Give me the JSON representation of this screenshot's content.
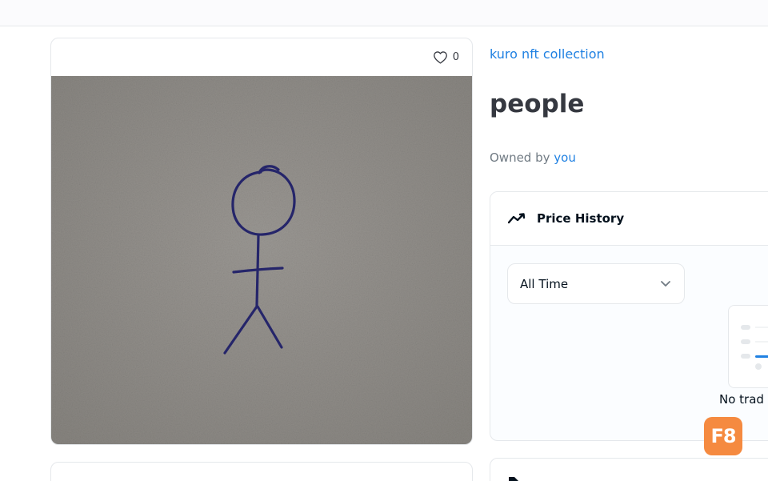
{
  "item": {
    "favorites_count": "0",
    "collection_name": "kuro nft collection",
    "title": "people",
    "owned_by_label": "Owned by",
    "owner": "you"
  },
  "price_history": {
    "title": "Price History",
    "time_filter": "All Time",
    "empty_text": "No trad"
  },
  "badge": {
    "label": "F8"
  },
  "icons": {
    "favorite": "heart-icon",
    "price_history": "trending-line-icon",
    "dropdown": "chevron-down-icon",
    "listings": "tag-icon"
  },
  "colors": {
    "link": "#2081e2",
    "text": "#353840",
    "muted": "#707a83",
    "border": "#e5e8eb",
    "badge": "#f58a40"
  }
}
